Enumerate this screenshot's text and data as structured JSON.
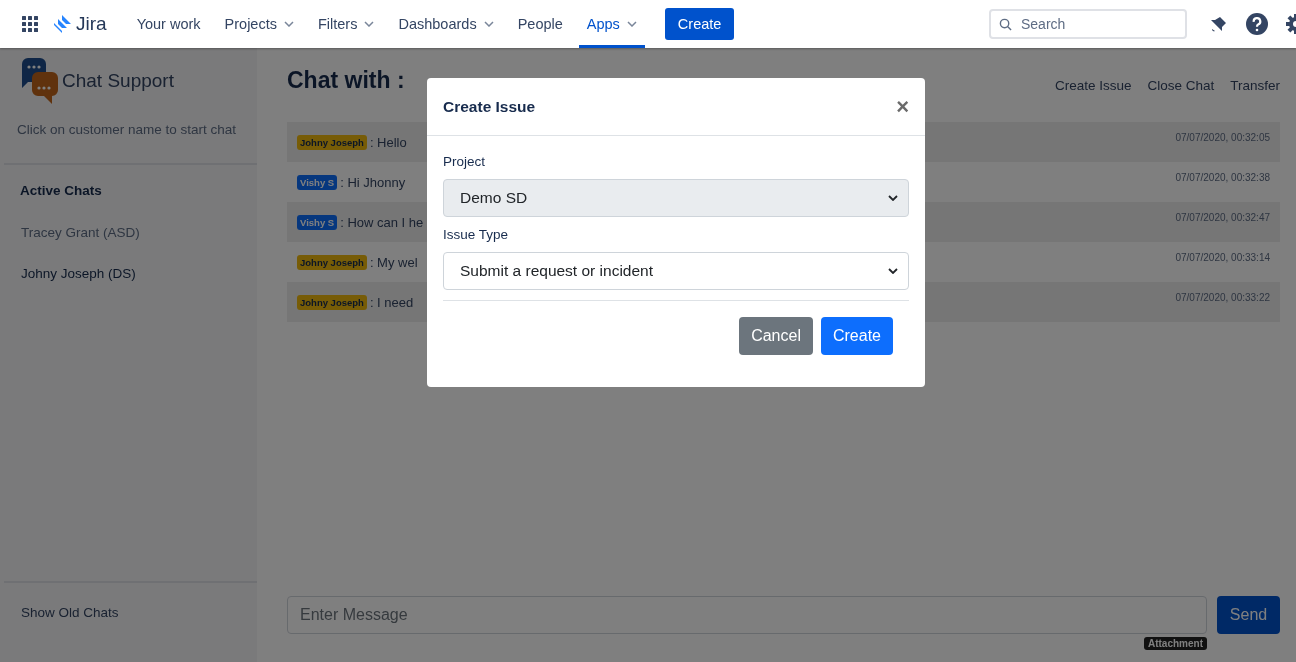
{
  "topbar": {
    "product": "Jira",
    "nav": [
      {
        "label": "Your work",
        "dropdown": false,
        "selected": false
      },
      {
        "label": "Projects",
        "dropdown": true,
        "selected": false
      },
      {
        "label": "Filters",
        "dropdown": true,
        "selected": false
      },
      {
        "label": "Dashboards",
        "dropdown": true,
        "selected": false
      },
      {
        "label": "People",
        "dropdown": false,
        "selected": false
      },
      {
        "label": "Apps",
        "dropdown": true,
        "selected": true
      }
    ],
    "create": "Create",
    "search": {
      "placeholder": "Search"
    }
  },
  "sidebar": {
    "title": "Chat Support",
    "hint": "Click on customer name to start chat",
    "section": "Active Chats",
    "chats": [
      {
        "label": "Tracey Grant (ASD)",
        "selected": false
      },
      {
        "label": "Johny Joseph (DS)",
        "selected": true
      }
    ],
    "footer": "Show Old Chats"
  },
  "chat": {
    "title": "Chat with :",
    "actions": [
      "Create Issue",
      "Close Chat",
      "Transfer"
    ],
    "messages": [
      {
        "sender": "Johny Joseph",
        "kind": "customer",
        "text": ": Hello",
        "time": "07/07/2020, 00:32:05"
      },
      {
        "sender": "Vishy S",
        "kind": "agent",
        "text": ": Hi Jhonny",
        "time": "07/07/2020, 00:32:38"
      },
      {
        "sender": "Vishy S",
        "kind": "agent",
        "text": ": How can I he",
        "time": "07/07/2020, 00:32:47"
      },
      {
        "sender": "Johny Joseph",
        "kind": "customer",
        "text": ": My wel",
        "time": "07/07/2020, 00:33:14"
      },
      {
        "sender": "Johny Joseph",
        "kind": "customer",
        "text": ": I need",
        "time": "07/07/2020, 00:33:22"
      }
    ],
    "input": {
      "placeholder": "Enter Message"
    },
    "send": "Send",
    "tooltip": "Attachment"
  },
  "modal": {
    "title": "Create Issue",
    "close": "×",
    "fields": [
      {
        "label": "Project",
        "value": "Demo SD",
        "disabled": true
      },
      {
        "label": "Issue Type",
        "value": "Submit a request or incident",
        "disabled": false
      }
    ],
    "buttons": [
      {
        "label": "Cancel",
        "kind": "secondary"
      },
      {
        "label": "Create",
        "kind": "primary"
      }
    ]
  }
}
